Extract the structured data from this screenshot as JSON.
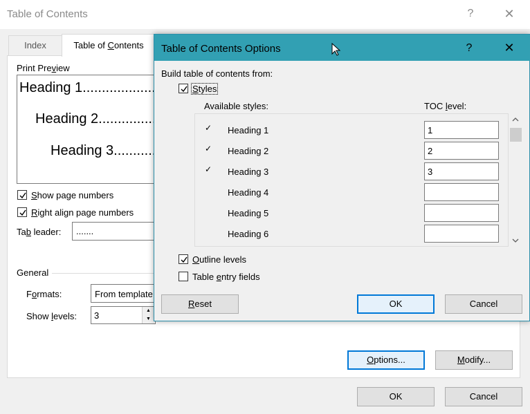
{
  "outer_dialog": {
    "title": "Table of Contents",
    "help_glyph": "?",
    "close_glyph": "✕",
    "tabs": [
      {
        "label": "Index",
        "selected": false
      },
      {
        "label": "Table of Contents",
        "selected": true
      }
    ],
    "print_preview": {
      "label": "Print Preview",
      "lines": [
        "Heading 1....................",
        "Heading 2....................",
        "Heading 3...................."
      ]
    },
    "show_page_numbers": {
      "label": "Show page numbers",
      "checked": true
    },
    "right_align": {
      "label": "Right align page numbers",
      "checked": true
    },
    "tab_leader": {
      "label": "Tab leader:",
      "value": "......."
    },
    "general": {
      "label": "General",
      "formats_label": "Formats:",
      "formats_value": "From template",
      "show_levels_label": "Show levels:",
      "show_levels_value": "3"
    },
    "buttons": {
      "options": "Options...",
      "modify": "Modify...",
      "ok": "OK",
      "cancel": "Cancel"
    }
  },
  "inner_dialog": {
    "title": "Table of Contents Options",
    "help_glyph": "?",
    "close_glyph": "✕",
    "build_label": "Build table of contents from:",
    "styles": {
      "label": "Styles",
      "checked": true
    },
    "available_styles_label": "Available styles:",
    "toc_level_label": "TOC level:",
    "style_rows": [
      {
        "name": "Heading 1",
        "checked": true,
        "level": "1"
      },
      {
        "name": "Heading 2",
        "checked": true,
        "level": "2"
      },
      {
        "name": "Heading 3",
        "checked": true,
        "level": "3"
      },
      {
        "name": "Heading 4",
        "checked": false,
        "level": ""
      },
      {
        "name": "Heading 5",
        "checked": false,
        "level": ""
      },
      {
        "name": "Heading 6",
        "checked": false,
        "level": ""
      }
    ],
    "outline_levels": {
      "label": "Outline levels",
      "checked": true
    },
    "table_entry_fields": {
      "label": "Table entry fields",
      "checked": false
    },
    "buttons": {
      "reset": "Reset",
      "ok": "OK",
      "cancel": "Cancel"
    }
  },
  "colors": {
    "inner_titlebar": "#32a0b3",
    "focus_border": "#0078d7"
  }
}
